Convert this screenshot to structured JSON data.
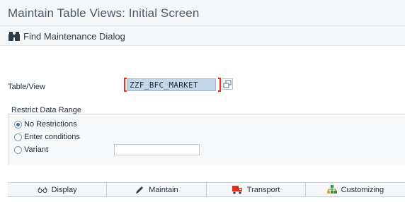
{
  "window": {
    "title": "Maintain Table Views: Initial Screen"
  },
  "toolbar": {
    "find_label": "Find Maintenance Dialog",
    "find_icon": "binoculars-icon"
  },
  "table_view": {
    "label": "Table/View",
    "value": "ZZF_BFC_MARKET"
  },
  "restrict": {
    "title": "Restrict Data Range",
    "options": [
      "No Restrictions",
      "Enter conditions",
      "Variant"
    ],
    "selected": "No Restrictions",
    "variant_value": ""
  },
  "buttons": {
    "display": "Display",
    "maintain": "Maintain",
    "transport": "Transport",
    "customizing": "Customizing"
  },
  "colors": {
    "highlight": "#c3d6ea",
    "bracket": "#e2301e",
    "transport_icon": "#e2301e",
    "customizing_icon": "#3a8a3a"
  }
}
